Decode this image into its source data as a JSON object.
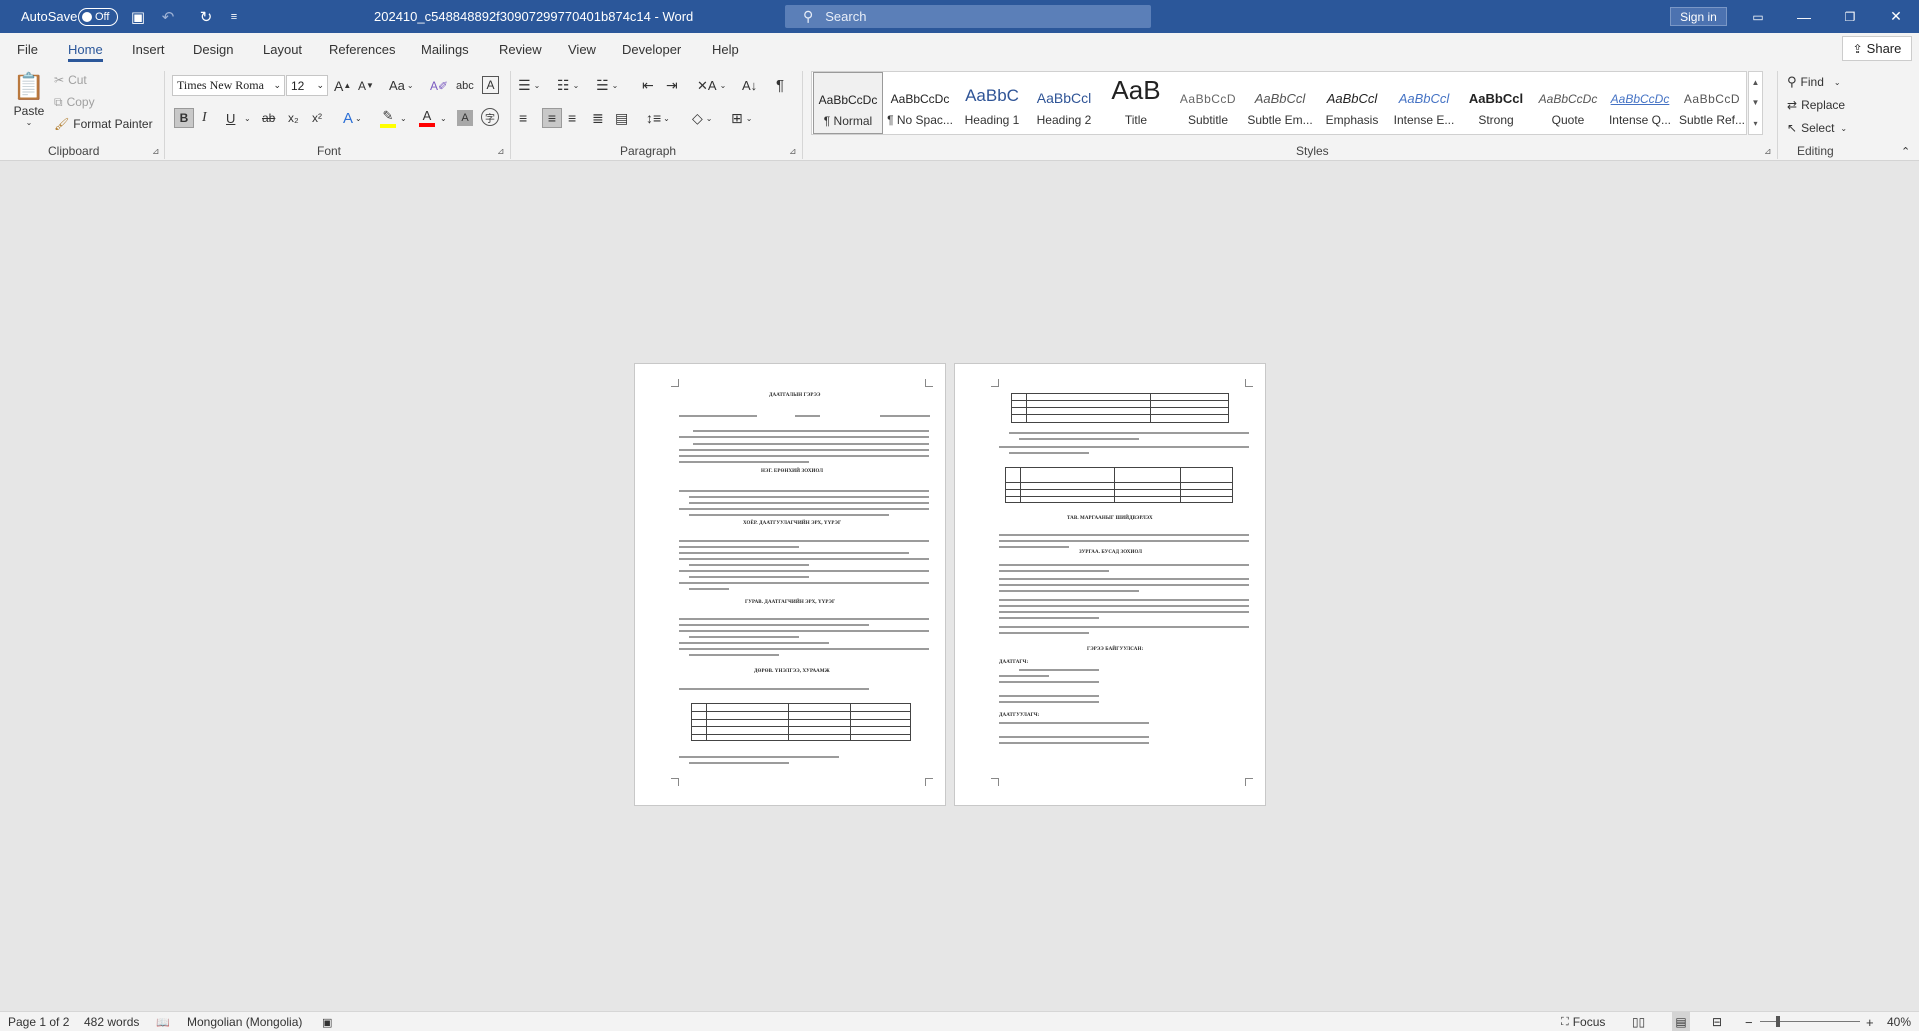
{
  "titlebar": {
    "autosave_label": "AutoSave",
    "autosave_state": "Off",
    "document_title": "202410_c548848892f30907299770401b874c14  -  Word",
    "search_placeholder": "Search",
    "signin_label": "Sign in"
  },
  "tabs": [
    "File",
    "Home",
    "Insert",
    "Design",
    "Layout",
    "References",
    "Mailings",
    "Review",
    "View",
    "Developer",
    "Help"
  ],
  "share_label": "Share",
  "clipboard": {
    "paste": "Paste",
    "cut": "Cut",
    "copy": "Copy",
    "format_painter": "Format Painter",
    "group": "Clipboard"
  },
  "font": {
    "name": "Times New Roma",
    "size": "12",
    "grow": "A",
    "shrink": "A",
    "change_case": "Aa",
    "group": "Font",
    "bold": "B",
    "italic": "I",
    "underline": "U",
    "strike": "ab",
    "subscript": "x₂",
    "superscript": "x²"
  },
  "paragraph": {
    "group": "Paragraph"
  },
  "styles": {
    "group": "Styles",
    "items": [
      {
        "preview": "AaBbCcDc",
        "name": "¶ Normal"
      },
      {
        "preview": "AaBbCcDc",
        "name": "¶ No Spac..."
      },
      {
        "preview": "AaBbC",
        "name": "Heading 1"
      },
      {
        "preview": "AaBbCcl",
        "name": "Heading 2"
      },
      {
        "preview": "AaB",
        "name": "Title"
      },
      {
        "preview": "AaBbCcD",
        "name": "Subtitle"
      },
      {
        "preview": "AaBbCcl",
        "name": "Subtle Em..."
      },
      {
        "preview": "AaBbCcl",
        "name": "Emphasis"
      },
      {
        "preview": "AaBbCcl",
        "name": "Intense E..."
      },
      {
        "preview": "AaBbCcl",
        "name": "Strong"
      },
      {
        "preview": "AaBbCcDc",
        "name": "Quote"
      },
      {
        "preview": "AaBbCcDc",
        "name": "Intense Q..."
      },
      {
        "preview": "AaBbCcD",
        "name": "Subtle Ref..."
      }
    ]
  },
  "editing": {
    "group": "Editing",
    "find": "Find",
    "replace": "Replace",
    "select": "Select"
  },
  "colors": {
    "brand": "#2b579a",
    "highlight": "#ffff00",
    "font_color": "#ff0000"
  },
  "page1": {
    "title": "ДААТГАЛЫН ГЭРЭЭ",
    "heading1": "НЭГ. ЕРӨНХИЙ ЗОХИОЛ",
    "heading2": "ХОЁР. ДААТГУУЛАГЧИЙН ЭРХ, ҮҮРЭГ",
    "heading3": "ГУРАВ. ДААТГАГЧИЙН ЭРХ, ҮҮРЭГ",
    "heading4": "ДӨРӨВ. ҮНЭЛГЭЭ, ХУРААМЖ"
  },
  "page2": {
    "heading5": "ТАВ. МАРГААНЫГ ШИЙДВЭРЛЭХ",
    "heading6": "ЗУРГАА. БУСАД ЗОХИОЛ",
    "heading7": "ГЭРЭЭ БАЙГУУЛСАН:",
    "insurer": "ДААТГАГЧ:",
    "insured": "ДААТГУУЛАГЧ:"
  },
  "status": {
    "page": "Page 1 of 2",
    "words": "482 words",
    "language": "Mongolian (Mongolia)",
    "focus": "Focus",
    "zoom": "40%"
  }
}
